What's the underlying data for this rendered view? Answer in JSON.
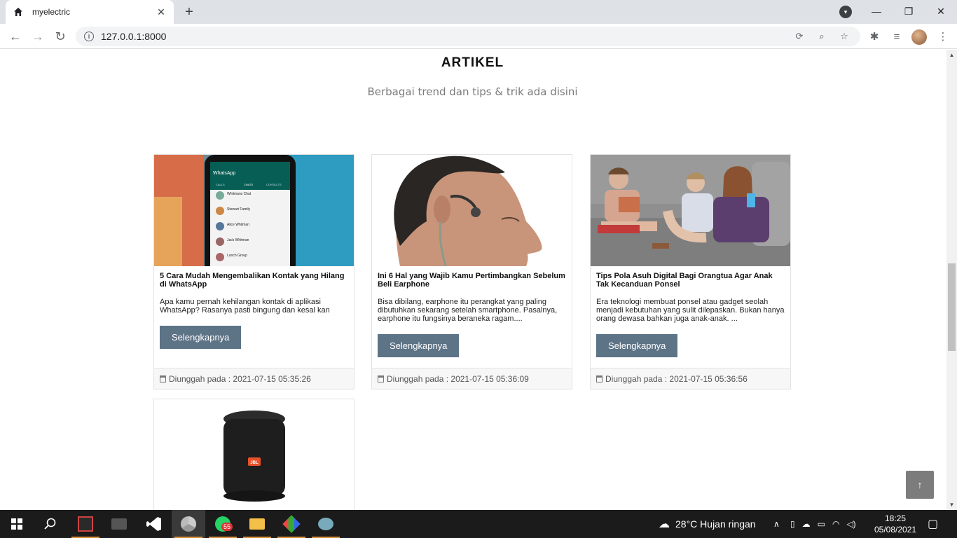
{
  "browser": {
    "tab_title": "myelectric",
    "url": "127.0.0.1:8000"
  },
  "page": {
    "section_title": "ARTIKEL",
    "section_subtitle": "Berbagai trend dan tips & trik ada disini",
    "articles": [
      {
        "title": "5 Cara Mudah Mengembalikan Kontak yang Hilang di WhatsApp",
        "excerpt": "Apa kamu pernah kehilangan kontak di aplikasi WhatsApp? Rasanya pasti bingung dan kesal kan",
        "button": "Selengkapnya",
        "uploaded": "Diunggah pada : 2021-07-15 05:35:26"
      },
      {
        "title": "Ini 6 Hal yang Wajib Kamu Pertimbangkan Sebelum Beli Earphone",
        "excerpt": "Bisa dibilang, earphone itu perangkat yang paling dibutuhkan sekarang setelah smartphone. Pasalnya, earphone itu fungsinya beraneka ragam....",
        "button": "Selengkapnya",
        "uploaded": "Diunggah pada : 2021-07-15 05:36:09"
      },
      {
        "title": "Tips Pola Asuh Digital Bagi Orangtua Agar Anak Tak Kecanduan Ponsel",
        "excerpt": "Era teknologi membuat ponsel atau gadget seolah menjadi kebutuhan yang sulit dilepaskan. Bukan hanya orang dewasa bahkan juga anak-anak. ...",
        "button": "Selengkapnya",
        "uploaded": "Diunggah pada : 2021-07-15 05:36:56"
      }
    ],
    "phone_screen": {
      "app": "WhatsApp",
      "tabs": [
        "CALLS",
        "CHATS",
        "CONTACTS"
      ],
      "chats": [
        "Whitmans Chat",
        "Stewart Family",
        "Alice Whitman",
        "Jack Whitman",
        "Lunch Group"
      ]
    },
    "speaker_logo": "JBL"
  },
  "taskbar": {
    "weather": "28°C  Hujan ringan",
    "time": "18:25",
    "date": "05/08/2021",
    "whatsapp_badge": "55"
  }
}
